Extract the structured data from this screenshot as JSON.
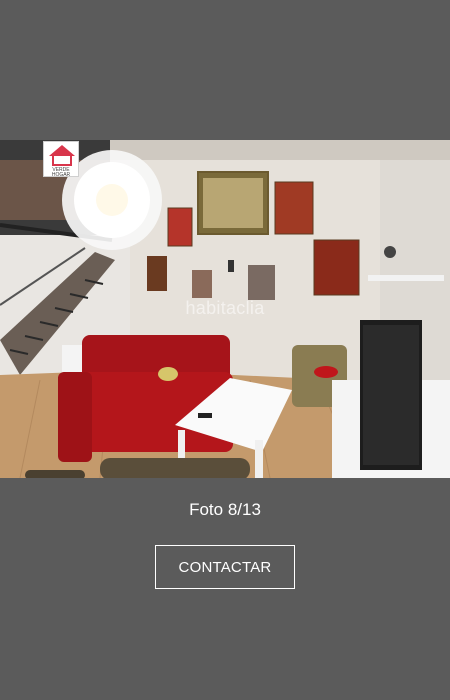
{
  "photo": {
    "watermark": "habitaclia",
    "agency_logo_text": "VERDE HOGAR",
    "description_alt": "Salón con sofá rojo, lámpara blanca, mesa de centro blanca y escalera metálica"
  },
  "viewer": {
    "caption": "Foto 8/13"
  },
  "actions": {
    "contact_label": "CONTACTAR"
  },
  "colors": {
    "background": "#5b5b5b",
    "sofa": "#b4161b",
    "button_border": "#ffffff"
  }
}
